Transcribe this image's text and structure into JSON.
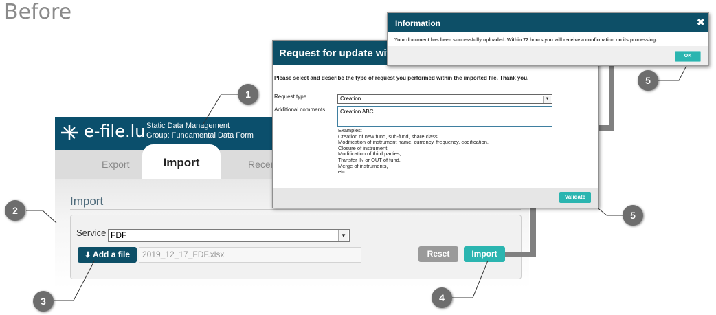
{
  "heading": "Before",
  "app": {
    "logo_text": "e-file.lu",
    "subtitle_line1": "Static Data Management",
    "subtitle_line2": "Group: Fundamental Data Form"
  },
  "tabs": [
    {
      "label": "Export"
    },
    {
      "label": "Import"
    },
    {
      "label": "Recen"
    }
  ],
  "import_form": {
    "heading": "Import",
    "service_label": "Service",
    "service_value": "FDF",
    "add_file_label": "Add a file",
    "file_name": "2019_12_17_FDF.xlsx",
    "reset_label": "Reset",
    "import_label": "Import"
  },
  "request_dialog": {
    "title": "Request for update wit",
    "intro": "Please select and describe the type of request you performed within the imported file. Thank you.",
    "request_type_label": "Request type",
    "request_type_value": "Creation",
    "comments_label": "Additional comments",
    "comments_value": "Creation ABC",
    "examples": [
      "Examples:",
      "Creation of new fund, sub-fund, share class,",
      "Modification of instrument name, currency, frequency, codification,",
      "Closure of instrument,",
      "Modification of third parties,",
      "Transfer IN or OUT of fund,",
      "Merge of instruments,",
      "etc."
    ],
    "validate_label": "Validate"
  },
  "info_dialog": {
    "title": "Information",
    "close_glyph": "✖",
    "message": "Your document has been successfully uploaded. Within 72 hours you will receive a confirmation on its processing.",
    "ok_label": "OK"
  },
  "callouts": [
    "1",
    "2",
    "3",
    "4",
    "5",
    "5"
  ],
  "colors": {
    "brand_dark": "#0d4f67",
    "accent_teal": "#2bb5b0",
    "callout_gray": "#6d6d6d",
    "arrow_gray": "#808080"
  }
}
